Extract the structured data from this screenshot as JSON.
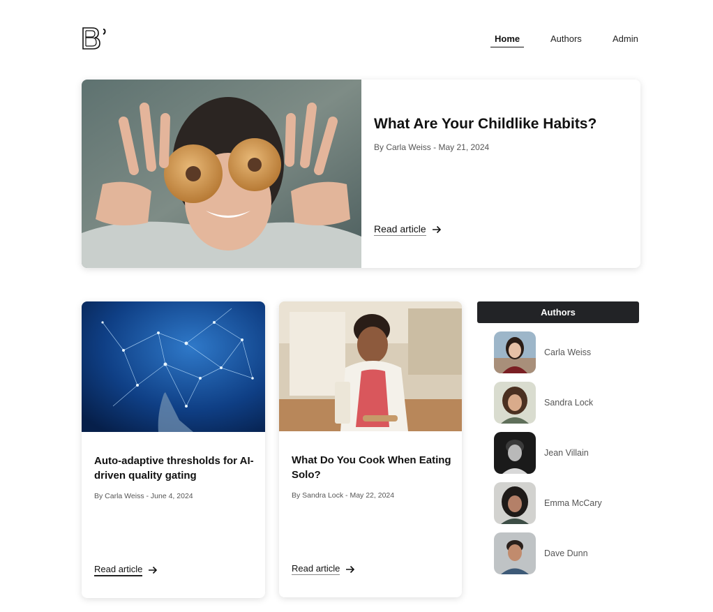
{
  "nav": {
    "items": [
      "Home",
      "Authors",
      "Admin"
    ]
  },
  "hero": {
    "title": "What Are Your Childlike Habits?",
    "byline": "By Carla Weiss - May 21, 2024",
    "read_label": "Read article"
  },
  "cards": [
    {
      "title": "Auto-adaptive thresholds for AI-driven quality gating",
      "byline": "By Carla Weiss - June 4, 2024",
      "read_label": "Read article"
    },
    {
      "title": "What Do You Cook When Eating Solo?",
      "byline": "By Sandra Lock - May 22, 2024",
      "read_label": "Read article"
    }
  ],
  "sidebar": {
    "title": "Authors",
    "authors": [
      {
        "name": "Carla Weiss"
      },
      {
        "name": "Sandra Lock"
      },
      {
        "name": "Jean Villain"
      },
      {
        "name": "Emma McCary"
      },
      {
        "name": "Dave Dunn"
      }
    ]
  }
}
